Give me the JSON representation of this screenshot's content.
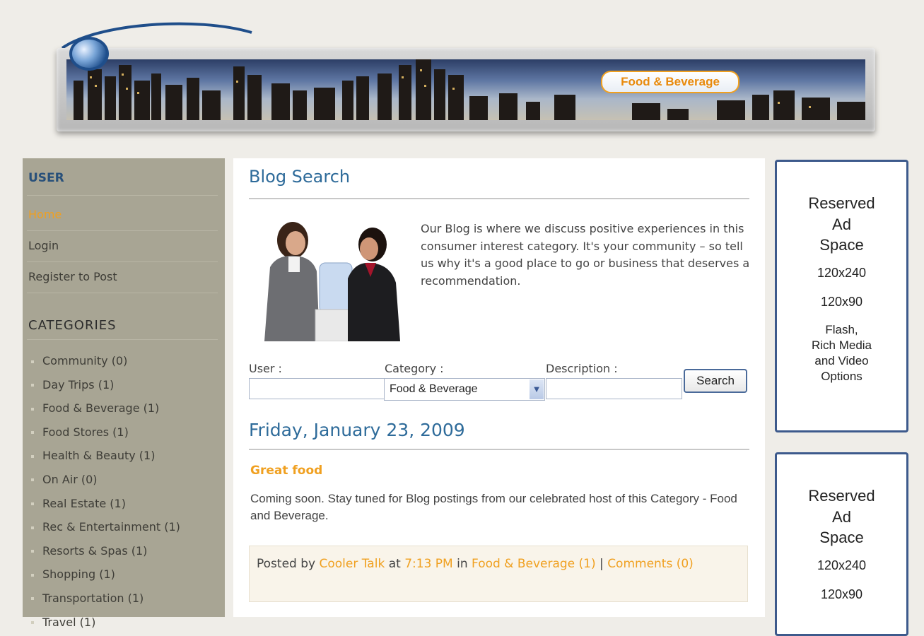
{
  "header": {
    "category_badge": "Food & Beverage"
  },
  "sidebar": {
    "user_heading": "USER",
    "user_links": [
      "Home",
      "Login",
      "Register to Post"
    ],
    "categories_heading": "CATEGORIES",
    "categories": [
      "Community (0)",
      "Day Trips (1)",
      "Food & Beverage (1)",
      "Food Stores (1)",
      "Health & Beauty (1)",
      "On Air (0)",
      "Real Estate (1)",
      "Rec & Entertainment (1)",
      "Resorts & Spas (1)",
      "Shopping (1)",
      "Transportation (1)",
      "Travel (1)"
    ]
  },
  "main": {
    "title": "Blog Search",
    "intro": "Our Blog is where we discuss positive experiences in this consumer interest category. It's your community – so tell us why it's a good place to go or business that deserves a recommendation.",
    "search": {
      "user_label": "User :",
      "user_value": "",
      "category_label": "Category :",
      "category_value": "Food & Beverage",
      "description_label": "Description :",
      "description_value": "",
      "button_label": "Search"
    },
    "post": {
      "date": "Friday, January 23, 2009",
      "title": "Great food",
      "body": "Coming soon. Stay tuned for Blog postings from our celebrated host of this Category - Food and Beverage.",
      "posted_by_prefix": "Posted by",
      "author": "Cooler Talk",
      "at_word": "at",
      "time": "7:13 PM",
      "in_word": "in",
      "category_link": "Food & Beverage (1)",
      "separator": "|",
      "comments_link": "Comments (0)"
    }
  },
  "ads": [
    {
      "title_lines": [
        "Reserved",
        "Ad",
        "Space"
      ],
      "size1": "120x240",
      "size2": "120x90",
      "note_lines": [
        "Flash,",
        "Rich Media",
        "and Video",
        "Options"
      ]
    },
    {
      "title_lines": [
        "Reserved",
        "Ad",
        "Space"
      ],
      "size1": "120x240",
      "size2": "120x90"
    }
  ],
  "colors": {
    "accent_orange": "#f0a020",
    "title_blue": "#2e6b9a",
    "sidebar_bg": "#a8a594",
    "ad_border": "#3d5a8c"
  }
}
